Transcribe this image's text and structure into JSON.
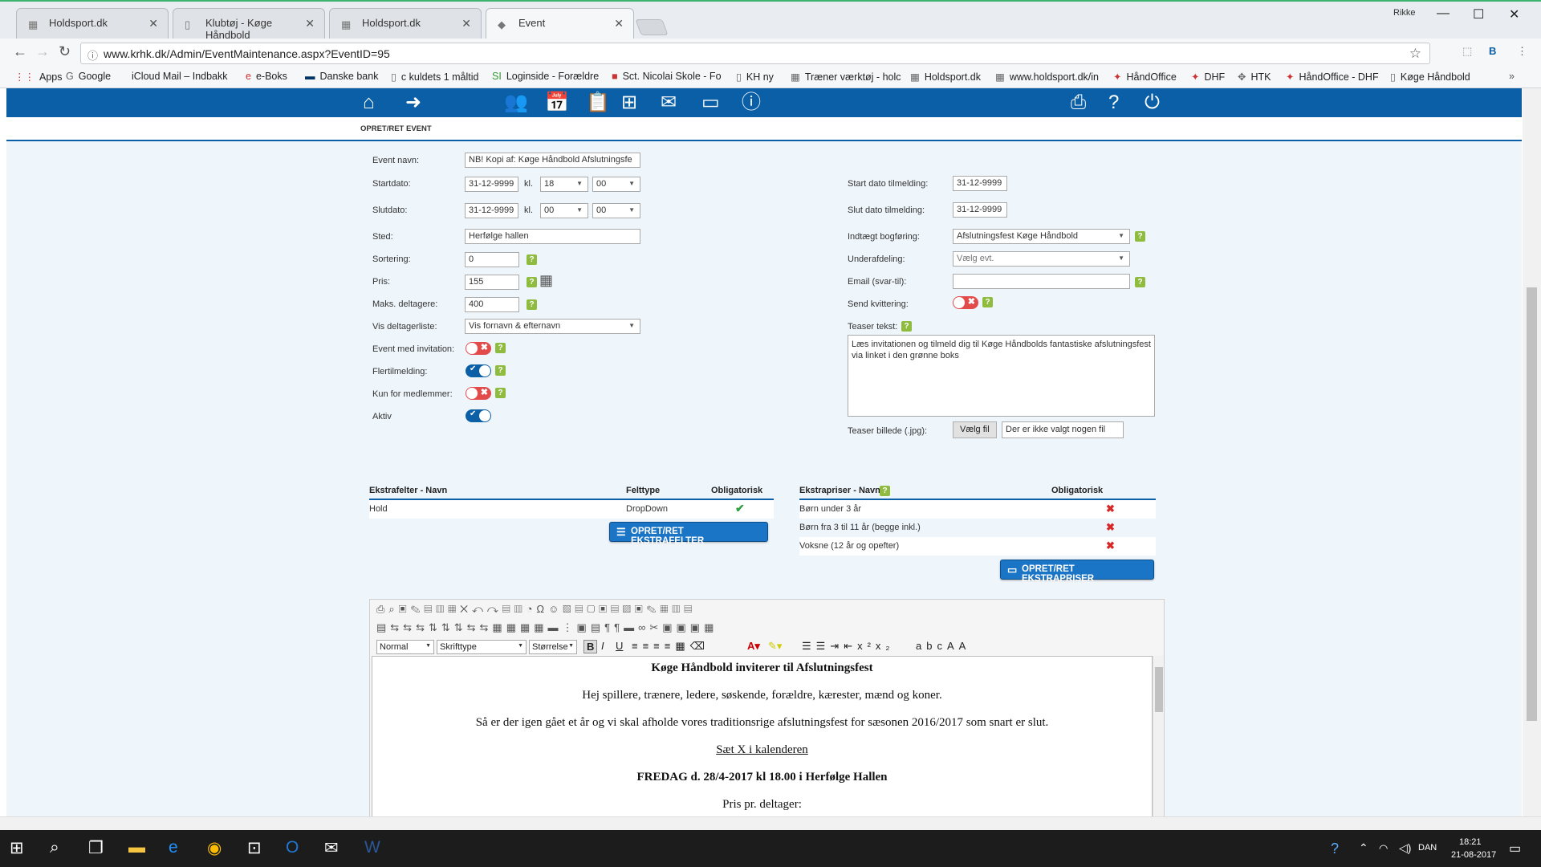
{
  "browser": {
    "tabs": [
      {
        "title": "Holdsport.dk"
      },
      {
        "title": "Klubtøj - Køge Håndbold"
      },
      {
        "title": "Holdsport.dk"
      },
      {
        "title": "Event"
      }
    ],
    "user": "Rikke",
    "url": "www.krhk.dk/Admin/EventMaintenance.aspx?EventID=95",
    "bookmarks": [
      "Apps",
      "Google",
      "iCloud Mail – Indbakk",
      "e-Boks",
      "Danske bank",
      "c kuldets 1 måltid",
      "Loginside - Forældre",
      "Sct. Nicolai Skole - Fo",
      "KH ny",
      "Træner værktøj - holc",
      "Holdsport.dk",
      "www.holdsport.dk/in",
      "HåndOffice",
      "DHF",
      "HTK",
      "HåndOffice - DHF",
      "Køge Håndbold"
    ]
  },
  "page": {
    "breadcrumb": "OPRET/RET EVENT",
    "left_form": {
      "event_name_label": "Event navn:",
      "event_name_value": "NB! Kopi af: Køge Håndbold Afslutningsfe",
      "start_label": "Startdato:",
      "start_date": "31-12-9999",
      "kl": "kl.",
      "start_hour": "18",
      "start_min": "00",
      "end_label": "Slutdato:",
      "end_date": "31-12-9999",
      "end_hour": "00",
      "end_min": "00",
      "place_label": "Sted:",
      "place_value": "Herfølge hallen",
      "sort_label": "Sortering:",
      "sort_value": "0",
      "price_label": "Pris:",
      "price_value": "155",
      "max_label": "Maks. deltagere:",
      "max_value": "400",
      "list_label": "Vis deltagerliste:",
      "list_value": "Vis fornavn & efternavn",
      "invitation_label": "Event med invitation:",
      "multi_label": "Flertilmelding:",
      "members_label": "Kun for medlemmer:",
      "active_label": "Aktiv"
    },
    "right_form": {
      "reg_start_label": "Start dato tilmelding:",
      "reg_start_value": "31-12-9999",
      "reg_end_label": "Slut dato tilmelding:",
      "reg_end_value": "31-12-9999",
      "income_label": "Indtægt bogføring:",
      "income_value": "Afslutningsfest Køge Håndbold",
      "sub_label": "Underafdeling:",
      "sub_value": "Vælg evt.",
      "email_label": "Email (svar-til):",
      "email_value": "",
      "receipt_label": "Send kvittering:",
      "teaser_label": "Teaser tekst:",
      "teaser_text": "Læs invitationen og tilmeld dig til Køge Håndbolds fantastiske afslutningsfest via linket i den grønne boks",
      "image_label": "Teaser billede (.jpg):",
      "file_button": "Vælg fil",
      "file_status": "Der er ikke valgt nogen fil"
    },
    "extra_fields": {
      "col_name": "Ekstrafelter - Navn",
      "col_type": "Felttype",
      "col_req": "Obligatorisk",
      "rows": [
        {
          "name": "Hold",
          "type": "DropDown",
          "required": true
        }
      ],
      "button": "OPRET/RET EKSTRAFELTER"
    },
    "extra_prices": {
      "col_name": "Ekstrapriser - Navn",
      "col_req": "Obligatorisk",
      "rows": [
        {
          "name": "Børn under 3 år",
          "required": false
        },
        {
          "name": "Børn fra 3 til 11 år (begge inkl.)",
          "required": false
        },
        {
          "name": "Voksne (12 år og opefter)",
          "required": false
        }
      ],
      "button": "OPRET/RET EKSTRAPRISER"
    },
    "editor": {
      "format": "Normal",
      "font": "Skrifttype",
      "size": "Størrelse",
      "content": [
        "Køge Håndbold inviterer til Afslutningsfest",
        "Hej spillere, trænere, ledere, søskende, forældre, kærester, mænd og koner.",
        "Så er der igen gået et år og vi skal afholde vores traditionsrige afslutningsfest for sæsonen 2016/2017 som snart er slut.",
        "Sæt X i kalenderen",
        "FREDAG d. 28/4-2017 kl 18.00 i Herfølge Hallen",
        "Pris pr. deltager:"
      ]
    }
  },
  "taskbar": {
    "lang": "DAN",
    "time": "18:21",
    "date": "21-08-2017"
  },
  "colors": {
    "nav_blue": "#0a5fa6",
    "help_green": "#8fbc3f",
    "toggle_off": "#e34b4b"
  }
}
